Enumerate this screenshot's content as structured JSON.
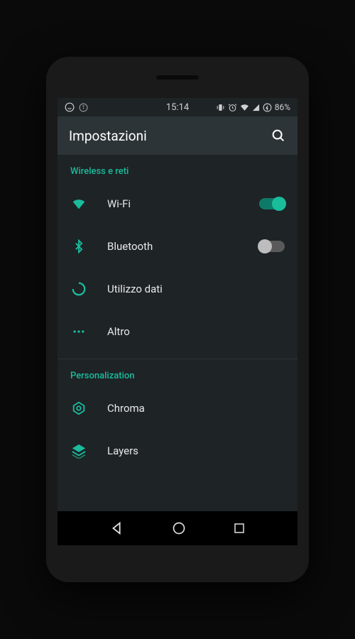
{
  "status": {
    "time": "15:14",
    "battery": "86%"
  },
  "appbar": {
    "title": "Impostazioni"
  },
  "sections": [
    {
      "header": "Wireless e reti",
      "items": [
        {
          "label": "Wi-Fi",
          "toggle": "on"
        },
        {
          "label": "Bluetooth",
          "toggle": "off"
        },
        {
          "label": "Utilizzo dati"
        },
        {
          "label": "Altro"
        }
      ]
    },
    {
      "header": "Personalization",
      "items": [
        {
          "label": "Chroma"
        },
        {
          "label": "Layers"
        }
      ]
    }
  ],
  "colors": {
    "accent": "#1abc9c",
    "background": "#1e2326",
    "appbar": "#2d3438"
  }
}
